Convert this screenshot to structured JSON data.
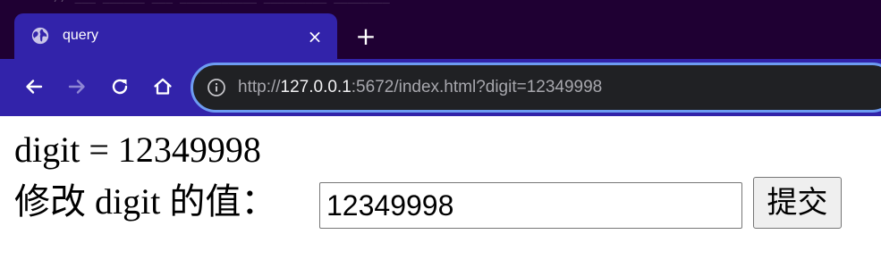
{
  "browser": {
    "tab": {
      "title": "query",
      "close_symbol": "×"
    },
    "new_tab_symbol": "+",
    "address": {
      "scheme": "http://",
      "host": "127.0.0.1",
      "rest": ":5672/index.html?digit=12349998"
    },
    "icons": {
      "favicon": "globe-icon",
      "back": "arrow-left-icon",
      "forward": "arrow-right-icon",
      "reload": "reload-icon",
      "home": "home-icon",
      "site_info": "info-icon"
    },
    "colors": {
      "title_bar": "#1f0033",
      "toolbar": "#3223aa",
      "omnibox_border": "#6d9cf2"
    }
  },
  "page": {
    "digit_display": "digit = 12349998",
    "form": {
      "label": "修改 digit 的值：",
      "input_value": "12349998",
      "submit_label": "提交"
    }
  }
}
